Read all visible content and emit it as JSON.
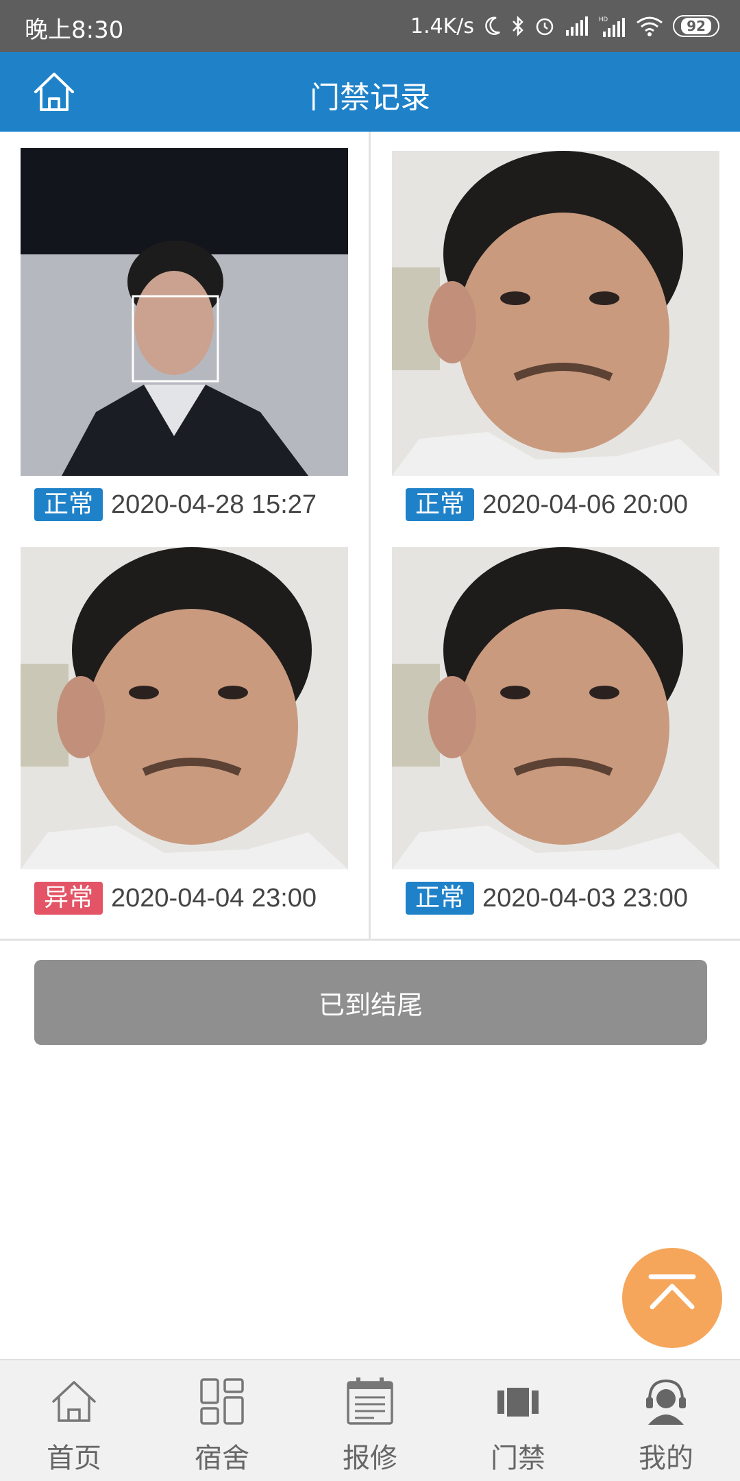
{
  "status_bar": {
    "time": "晚上8:30",
    "net_speed": "1.4K/s",
    "battery": "92"
  },
  "header": {
    "title": "门禁记录",
    "home_icon": "home-icon"
  },
  "records": [
    {
      "status": "正常",
      "status_type": "normal",
      "datetime": "2020-04-28 15:27"
    },
    {
      "status": "正常",
      "status_type": "normal",
      "datetime": "2020-04-06 20:00"
    },
    {
      "status": "异常",
      "status_type": "abnormal",
      "datetime": "2020-04-04 23:00"
    },
    {
      "status": "正常",
      "status_type": "normal",
      "datetime": "2020-04-03 23:00"
    }
  ],
  "end_label": "已到结尾",
  "colors": {
    "header_bg": "#1f82c9",
    "badge_normal": "#1f82c9",
    "badge_abnormal": "#e35466",
    "end_button_bg": "#8f8f8f",
    "back_to_top_bg": "#f5a65b"
  },
  "bottom_nav": [
    {
      "label": "首页",
      "icon": "home-icon"
    },
    {
      "label": "宿舍",
      "icon": "dormitory-grid-icon"
    },
    {
      "label": "报修",
      "icon": "repair-calendar-icon"
    },
    {
      "label": "门禁",
      "icon": "access-control-icon"
    },
    {
      "label": "我的",
      "icon": "profile-headset-icon"
    }
  ]
}
